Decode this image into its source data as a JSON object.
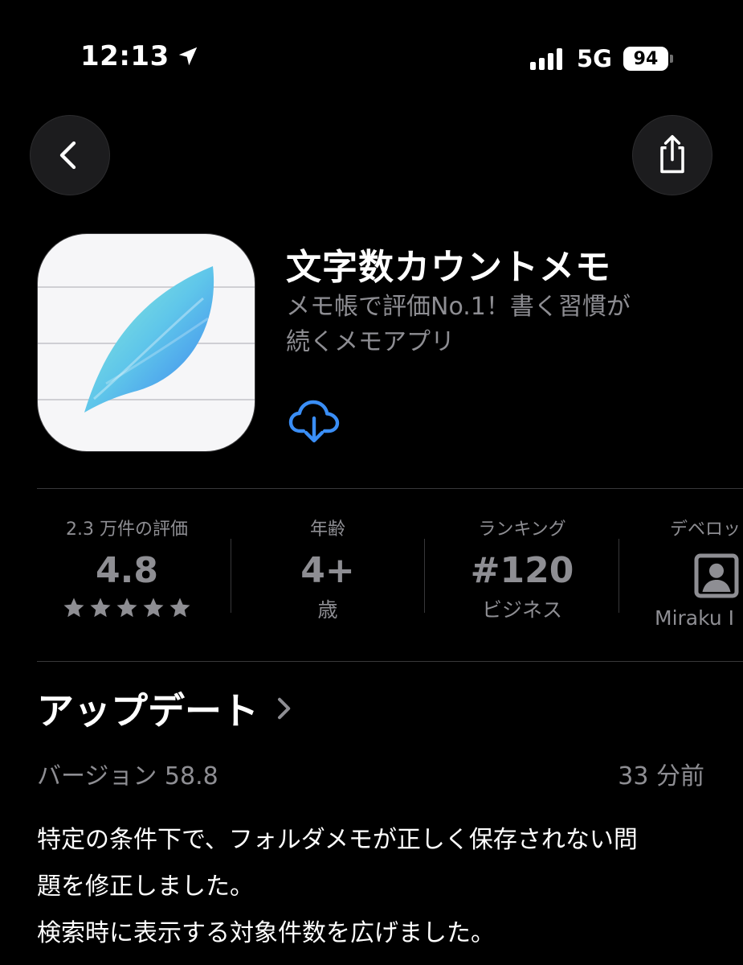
{
  "status_bar": {
    "time": "12:13",
    "network": "5G",
    "battery": "94"
  },
  "app": {
    "title": "文字数カウントメモ",
    "subtitle_line1": "メモ帳で評価No.1！書く習慣が",
    "subtitle_line2": "続くメモアプリ"
  },
  "stats": {
    "rating": {
      "label": "2.3 万件の評価",
      "value": "4.8",
      "stars": 5
    },
    "age": {
      "label": "年齢",
      "value": "4+",
      "sub": "歳"
    },
    "ranking": {
      "label": "ランキング",
      "value": "#120",
      "sub": "ビジネス"
    },
    "developer": {
      "label": "デベロッ",
      "sub": "Miraku I"
    }
  },
  "update": {
    "title": "アップデート",
    "version": "バージョン 58.8",
    "time_ago": "33 分前",
    "notes": [
      "特定の条件下で、フォルダメモが正しく保存されない問",
      "題を修正しました。",
      "検索時に表示する対象件数を広げました。"
    ]
  },
  "colors": {
    "background": "#000000",
    "secondary_text": "#8e8e93",
    "accent": "#3a8ef6",
    "divider": "#38383a"
  }
}
